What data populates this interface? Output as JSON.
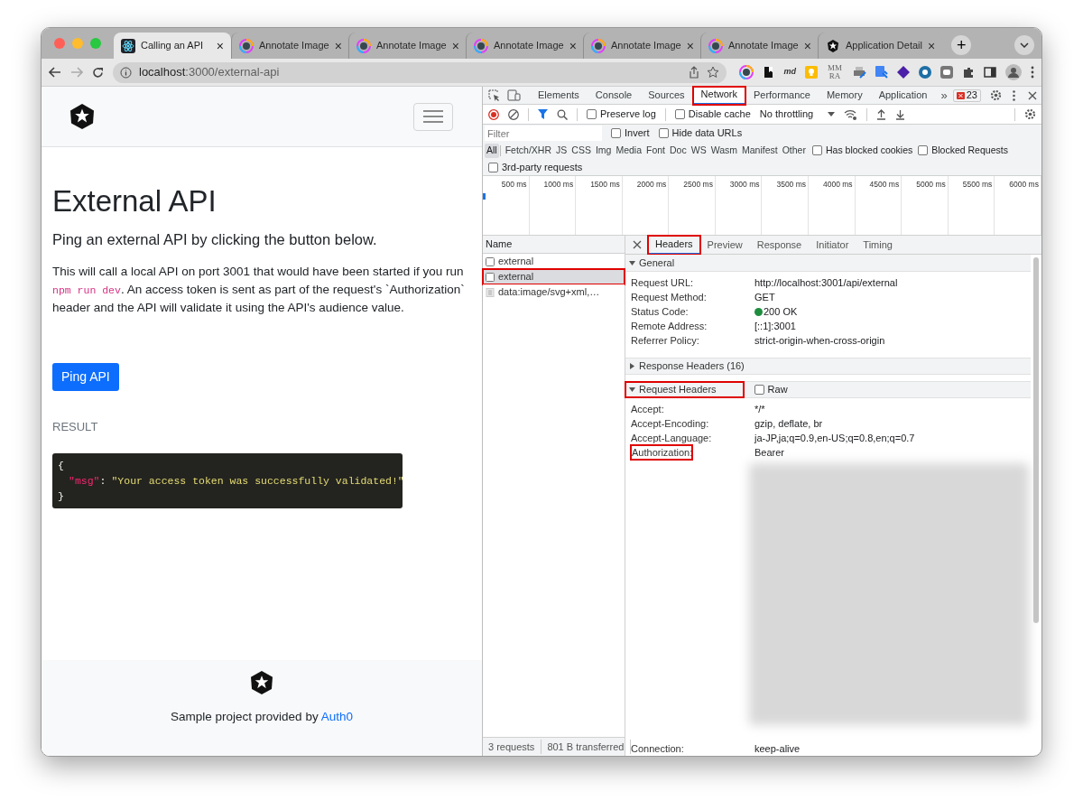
{
  "browser": {
    "tabs": [
      {
        "title": "Calling an API",
        "kind": "react",
        "selected": true
      },
      {
        "title": "Annotate Image",
        "kind": "annotate",
        "selected": false
      },
      {
        "title": "Annotate Image",
        "kind": "annotate",
        "selected": false
      },
      {
        "title": "Annotate Image",
        "kind": "annotate",
        "selected": false
      },
      {
        "title": "Annotate Image",
        "kind": "annotate",
        "selected": false
      },
      {
        "title": "Annotate Image",
        "kind": "annotate",
        "selected": false
      },
      {
        "title": "Application Detail",
        "kind": "auth0",
        "selected": false
      }
    ],
    "tab_close": "×",
    "new_tab": "+",
    "address": {
      "host": "localhost",
      "rest": ":3000/external-api"
    },
    "extension_labels": [
      "md",
      "MM RA"
    ]
  },
  "page": {
    "title": "External API",
    "lead": "Ping an external API by clicking the button below.",
    "description": [
      {
        "kind": "text",
        "text": "This will call a local API on port 3001 that would have been started if you run "
      },
      {
        "kind": "code",
        "text": "npm run dev"
      },
      {
        "kind": "text",
        "text": ". An access token is sent as part of the request's `Authorization` header and the API will validate it using the API's audience value."
      }
    ],
    "button": "Ping API",
    "result_label": "RESULT",
    "result": {
      "open": "{",
      "key": "\"msg\"",
      "separator": ":",
      "value": "\"Your access token was successfully validated!\"",
      "close": "}"
    },
    "footer": {
      "text": "Sample project provided by ",
      "link": "Auth0"
    }
  },
  "devtools": {
    "panels": [
      {
        "label": "Elements",
        "selected": false,
        "annotated": false
      },
      {
        "label": "Console",
        "selected": false,
        "annotated": false
      },
      {
        "label": "Sources",
        "selected": false,
        "annotated": false
      },
      {
        "label": "Network",
        "selected": true,
        "annotated": true
      },
      {
        "label": "Performance",
        "selected": false,
        "annotated": false
      },
      {
        "label": "Memory",
        "selected": false,
        "annotated": false
      },
      {
        "label": "Application",
        "selected": false,
        "annotated": false
      }
    ],
    "more": "»",
    "issues": "23",
    "toolbar": {
      "preserve_log": {
        "label": "Preserve log",
        "checked": false
      },
      "disable_cache": {
        "label": "Disable cache",
        "checked": false
      },
      "throttling": "No throttling"
    },
    "filter": {
      "placeholder": "Filter",
      "invert": {
        "label": "Invert",
        "checked": false
      },
      "hide_data_urls": {
        "label": "Hide data URLs",
        "checked": false
      }
    },
    "types": [
      {
        "label": "All",
        "selected": true
      },
      {
        "label": "Fetch/XHR",
        "selected": false
      },
      {
        "label": "JS",
        "selected": false
      },
      {
        "label": "CSS",
        "selected": false
      },
      {
        "label": "Img",
        "selected": false
      },
      {
        "label": "Media",
        "selected": false
      },
      {
        "label": "Font",
        "selected": false
      },
      {
        "label": "Doc",
        "selected": false
      },
      {
        "label": "WS",
        "selected": false
      },
      {
        "label": "Wasm",
        "selected": false
      },
      {
        "label": "Manifest",
        "selected": false
      },
      {
        "label": "Other",
        "selected": false
      }
    ],
    "blocked_cookies": {
      "label": "Has blocked cookies",
      "checked": false
    },
    "blocked_requests": {
      "label": "Blocked Requests",
      "checked": false
    },
    "third_party": {
      "label": "3rd-party requests",
      "checked": false
    },
    "timeline_ticks": [
      "500 ms",
      "1000 ms",
      "1500 ms",
      "2000 ms",
      "2500 ms",
      "3000 ms",
      "3500 ms",
      "4000 ms",
      "4500 ms",
      "5000 ms",
      "5500 ms",
      "6000 ms"
    ],
    "requests": {
      "header": "Name",
      "rows": [
        {
          "name": "external",
          "kind": "fetch",
          "selected": false,
          "annotated": false
        },
        {
          "name": "external",
          "kind": "fetch",
          "selected": true,
          "annotated": true
        },
        {
          "name": "data:image/svg+xml,…",
          "kind": "image",
          "selected": false,
          "annotated": false
        }
      ],
      "summary": [
        "3 requests",
        "801 B transferred"
      ]
    },
    "detail_tabs": [
      {
        "label": "Headers",
        "selected": true,
        "annotated": true
      },
      {
        "label": "Preview",
        "selected": false,
        "annotated": false
      },
      {
        "label": "Response",
        "selected": false,
        "annotated": false
      },
      {
        "label": "Initiator",
        "selected": false,
        "annotated": false
      },
      {
        "label": "Timing",
        "selected": false,
        "annotated": false
      }
    ],
    "sections": [
      {
        "title": "General",
        "expanded": true,
        "annotated": false,
        "rows": [
          {
            "name": "Request URL:",
            "value": "http://localhost:3001/api/external",
            "kind": "plain",
            "annotated": false
          },
          {
            "name": "Request Method:",
            "value": "GET",
            "kind": "plain",
            "annotated": false
          },
          {
            "name": "Status Code:",
            "value": "200 OK",
            "kind": "status",
            "annotated": false
          },
          {
            "name": "Remote Address:",
            "value": "[::1]:3001",
            "kind": "plain",
            "annotated": false
          },
          {
            "name": "Referrer Policy:",
            "value": "strict-origin-when-cross-origin",
            "kind": "plain",
            "annotated": false
          }
        ]
      },
      {
        "title": "Response Headers (16)",
        "expanded": false,
        "annotated": false
      },
      {
        "title": "Request Headers",
        "expanded": true,
        "annotated": true,
        "raw": {
          "label": "Raw",
          "checked": false
        },
        "rows": [
          {
            "name": "Accept:",
            "value": "*/*",
            "annotated": false
          },
          {
            "name": "Accept-Encoding:",
            "value": "gzip, deflate, br",
            "annotated": false
          },
          {
            "name": "Accept-Language:",
            "value": "ja-JP,ja;q=0.9,en-US;q=0.8,en;q=0.7",
            "annotated": false
          },
          {
            "name": "Authorization:",
            "value": "Bearer",
            "annotated": true,
            "redacted": true
          },
          {
            "name": "Connection:",
            "value": "keep-alive",
            "annotated": false
          }
        ]
      }
    ]
  }
}
